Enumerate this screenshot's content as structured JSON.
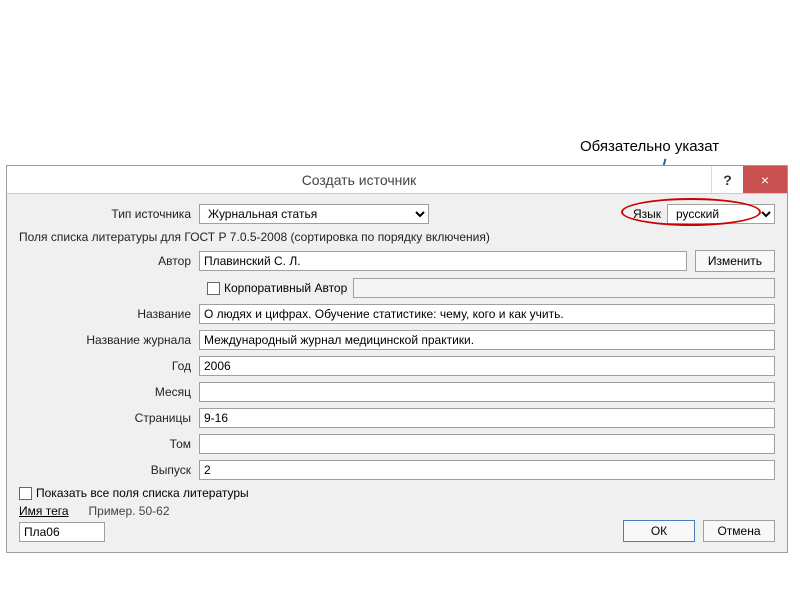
{
  "annotation": "Обязательно указат",
  "dialog": {
    "title": "Создать источник",
    "help": "?",
    "close": "×",
    "type_label": "Тип источника",
    "type_value": "Журнальная статья",
    "lang_label": "Язык",
    "lang_value": "русский",
    "section_title": "Поля списка литературы для ГОСТ Р 7.0.5-2008 (сортировка по порядку включения)",
    "author_label": "Автор",
    "author_value": "Плавинский С. Л.",
    "edit_btn": "Изменить",
    "corp_label": "Корпоративный Автор",
    "corp_value": "",
    "title_label": "Название",
    "title_value": "О людях и цифрах. Обучение статистике: чему, кого и как учить.",
    "journal_label": "Название журнала",
    "journal_value": "Международный журнал медицинской практики.",
    "year_label": "Год",
    "year_value": "2006",
    "month_label": "Месяц",
    "month_value": "",
    "pages_label": "Страницы",
    "pages_value": "9-16",
    "volume_label": "Том",
    "volume_value": "",
    "issue_label": "Выпуск",
    "issue_value": "2",
    "show_all": "Показать все поля списка литературы",
    "tag_label": "Имя тега",
    "example": "Пример. 50-62",
    "tag_value": "Пла06",
    "ok": "ОК",
    "cancel": "Отмена"
  }
}
